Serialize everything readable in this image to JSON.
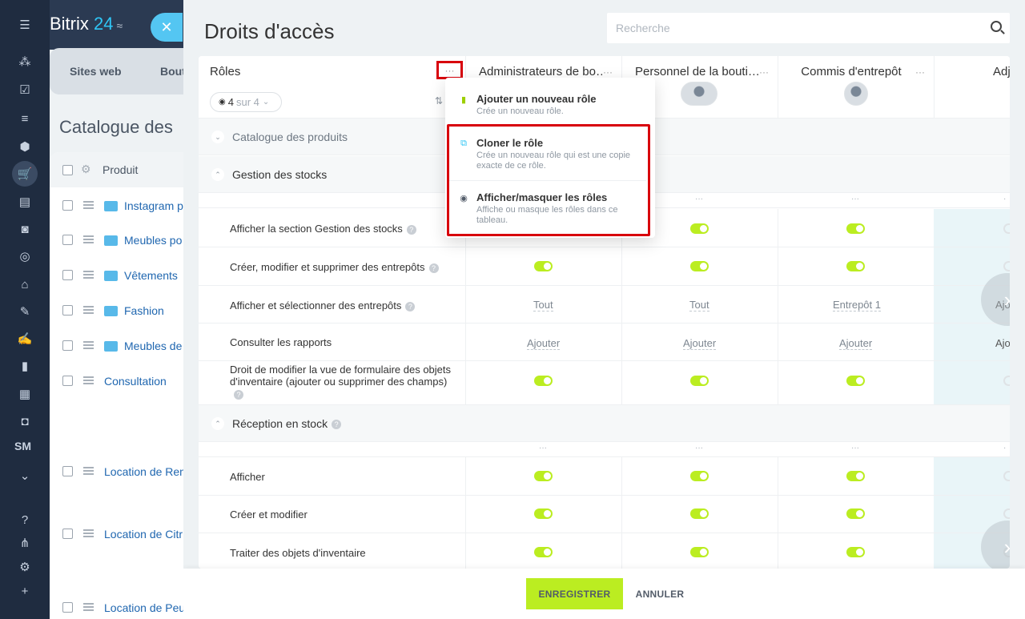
{
  "app": {
    "brand_prefix": "Bitrix",
    "brand_number": "24",
    "brand_suffix": "≈"
  },
  "bg_page": {
    "tabs": [
      "Sites web",
      "Bout"
    ],
    "title": "Catalogue des",
    "table_header": "Produit",
    "rows": [
      "Instagram p",
      "Meubles po",
      "Vêtements",
      "Fashion",
      "Meubles de",
      "Consultation",
      "Location de Ren",
      "Location de Citr",
      "Location de Peu"
    ]
  },
  "slider": {
    "title": "Droits d'accès",
    "search_placeholder": "Recherche",
    "roles_label": "Rôles",
    "counter": {
      "shown": "4",
      "of_label": "sur 4"
    },
    "columns": [
      {
        "name": "Administrateurs de bo…",
        "dots": "···"
      },
      {
        "name": "Personnel de la bouti…",
        "dots": "···"
      },
      {
        "name": "Commis d'entrepôt",
        "dots": "···"
      },
      {
        "name": "Adj"
      }
    ],
    "sections": {
      "catalogue": "Catalogue des produits",
      "stocks": "Gestion des stocks",
      "reception": "Réception en stock"
    },
    "rows": [
      {
        "label": "Afficher la section Gestion des stocks"
      },
      {
        "label": "Créer, modifier et supprimer des entrepôts"
      },
      {
        "label": "Afficher et sélectionner des entrepôts",
        "values": [
          "Tout",
          "Tout",
          "Entrepôt 1",
          "Ajo"
        ]
      },
      {
        "label": "Consulter les rapports",
        "values": [
          "Ajouter",
          "Ajouter",
          "Ajouter",
          "Ajo"
        ]
      },
      {
        "label": "Droit de modifier la vue de formulaire des objets d'inventaire (ajouter ou supprimer des champs)"
      },
      {
        "label": "Afficher"
      },
      {
        "label": "Créer et modifier"
      },
      {
        "label": "Traiter des objets d'inventaire"
      }
    ],
    "menu": [
      {
        "title": "Ajouter un nouveau rôle",
        "desc": "Crée un nouveau rôle."
      },
      {
        "title": "Cloner le rôle",
        "desc": "Crée un nouveau rôle qui est une copie exacte de ce rôle."
      },
      {
        "title": "Afficher/masquer les rôles",
        "desc": "Affiche ou masque les rôles dans ce tableau."
      }
    ],
    "footer": {
      "save": "ENREGISTRER",
      "cancel": "ANNULER"
    }
  },
  "colors": {
    "accent_green": "#bbed21",
    "highlight_red": "#d8000c",
    "sidebar": "#1f2c40",
    "link_blue": "#2067b0"
  }
}
